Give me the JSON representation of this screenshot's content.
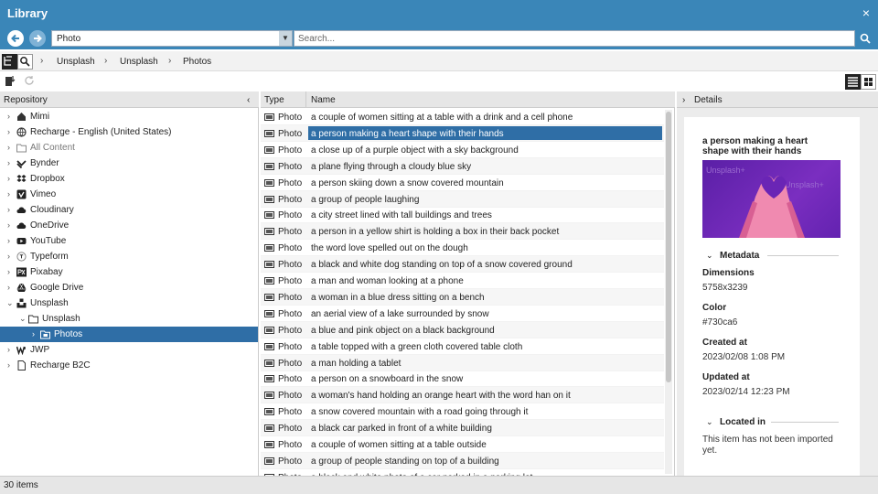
{
  "window": {
    "title": "Library",
    "close_label": "×"
  },
  "toolbar": {
    "source_value": "Photo",
    "search_placeholder": "Search..."
  },
  "breadcrumb": [
    "Unsplash",
    "Unsplash",
    "Photos"
  ],
  "repository": {
    "header": "Repository",
    "items": [
      {
        "label": "Mimi",
        "icon": "home-icon"
      },
      {
        "label": "Recharge - English (United States)",
        "icon": "globe-icon"
      },
      {
        "label": "All Content",
        "icon": "folder-icon"
      },
      {
        "label": "Bynder",
        "icon": "bynder-icon"
      },
      {
        "label": "Dropbox",
        "icon": "dropbox-icon"
      },
      {
        "label": "Vimeo",
        "icon": "vimeo-icon"
      },
      {
        "label": "Cloudinary",
        "icon": "cloud-icon"
      },
      {
        "label": "OneDrive",
        "icon": "cloud-icon"
      },
      {
        "label": "YouTube",
        "icon": "youtube-icon"
      },
      {
        "label": "Typeform",
        "icon": "typeform-icon"
      },
      {
        "label": "Pixabay",
        "icon": "pixabay-icon"
      },
      {
        "label": "Google Drive",
        "icon": "drive-icon"
      },
      {
        "label": "Unsplash",
        "icon": "unsplash-icon"
      },
      {
        "label": "Unsplash",
        "icon": "folder-icon"
      },
      {
        "label": "Photos",
        "icon": "photos-folder-icon"
      },
      {
        "label": "JWP",
        "icon": "jwp-icon"
      },
      {
        "label": "Recharge B2C",
        "icon": "document-icon"
      }
    ]
  },
  "list": {
    "col_type": "Type",
    "col_name": "Name",
    "rows": [
      {
        "type": "Photo",
        "name": "a couple of women sitting at a table with a drink and a cell phone"
      },
      {
        "type": "Photo",
        "name": "a person making a heart shape with their hands"
      },
      {
        "type": "Photo",
        "name": "a close up of a purple object with a sky background"
      },
      {
        "type": "Photo",
        "name": "a plane flying through a cloudy blue sky"
      },
      {
        "type": "Photo",
        "name": "a person skiing down a snow covered mountain"
      },
      {
        "type": "Photo",
        "name": "a group of people laughing"
      },
      {
        "type": "Photo",
        "name": "a city street lined with tall buildings and trees"
      },
      {
        "type": "Photo",
        "name": "a person in a yellow shirt is holding a box in their back pocket"
      },
      {
        "type": "Photo",
        "name": "the word love spelled out on the dough"
      },
      {
        "type": "Photo",
        "name": "a black and white dog standing on top of a snow covered ground"
      },
      {
        "type": "Photo",
        "name": "a man and woman looking at a phone"
      },
      {
        "type": "Photo",
        "name": "a woman in a blue dress sitting on a bench"
      },
      {
        "type": "Photo",
        "name": "an aerial view of a lake surrounded by snow"
      },
      {
        "type": "Photo",
        "name": "a blue and pink object on a black background"
      },
      {
        "type": "Photo",
        "name": "a table topped with a green cloth covered table cloth"
      },
      {
        "type": "Photo",
        "name": "a man holding a tablet"
      },
      {
        "type": "Photo",
        "name": "a person on a snowboard in the snow"
      },
      {
        "type": "Photo",
        "name": "a woman's hand holding an orange heart with the word han on it"
      },
      {
        "type": "Photo",
        "name": "a snow covered mountain with a road going through it"
      },
      {
        "type": "Photo",
        "name": "a black car parked in front of a white building"
      },
      {
        "type": "Photo",
        "name": "a couple of women sitting at a table outside"
      },
      {
        "type": "Photo",
        "name": "a group of people standing on top of a building"
      },
      {
        "type": "Photo",
        "name": "a black and white photo of a car parked in a parking lot"
      }
    ]
  },
  "details": {
    "header": "Details",
    "title": "a person making a heart shape with their hands",
    "metadata_label": "Metadata",
    "dimensions_label": "Dimensions",
    "dimensions_value": "5758x3239",
    "color_label": "Color",
    "color_value": "#730ca6",
    "created_label": "Created at",
    "created_value": "2023/02/08 1:08 PM",
    "updated_label": "Updated at",
    "updated_value": "2023/02/14 12:23 PM",
    "located_label": "Located in",
    "located_value": "This item has not been imported yet."
  },
  "status": {
    "count": "30 items"
  },
  "colors": {
    "accent": "#3a86b8",
    "selection": "#2f6ea6"
  }
}
